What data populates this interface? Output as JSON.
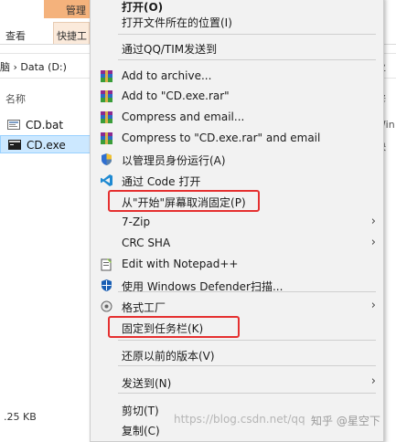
{
  "explorer": {
    "ribbon_tab_manage": "管理",
    "ribbon_tab_view": "查看",
    "ribbon_tab_shortcut": "快捷工",
    "address_path": "脑 › Data (D:)",
    "right_fragment_1": "业",
    "right_fragment_2": "修",
    "right_fragment_3": "Win",
    "right_fragment_4": "快",
    "column_name": "名称",
    "files": [
      {
        "name": "CD.bat",
        "selected": false
      },
      {
        "name": "CD.exe",
        "selected": true
      }
    ],
    "status_size": ".25 KB"
  },
  "context_menu": {
    "items": [
      {
        "label": "打开(O)",
        "icon": "none"
      },
      {
        "label": "打开文件所在的位置(I)",
        "icon": "none"
      },
      {
        "label": "通过QQ/TIM发送到",
        "icon": "none"
      },
      {
        "label": "Add to archive...",
        "icon": "winrar-icon"
      },
      {
        "label": "Add to \"CD.exe.rar\"",
        "icon": "winrar-icon"
      },
      {
        "label": "Compress and email...",
        "icon": "winrar-icon"
      },
      {
        "label": "Compress to \"CD.exe.rar\" and email",
        "icon": "winrar-icon"
      },
      {
        "label": "以管理员身份运行(A)",
        "icon": "uac-shield-icon"
      },
      {
        "label": "通过 Code 打开",
        "icon": "vscode-icon"
      },
      {
        "label": "从\"开始\"屏幕取消固定(P)",
        "icon": "none"
      },
      {
        "label": "7-Zip",
        "icon": "none",
        "submenu": true
      },
      {
        "label": "CRC SHA",
        "icon": "none",
        "submenu": true
      },
      {
        "label": "Edit with Notepad++",
        "icon": "notepad-plus-plus-icon"
      },
      {
        "label": "使用 Windows Defender扫描...",
        "icon": "windows-defender-icon"
      },
      {
        "label": "格式工厂",
        "icon": "format-factory-icon",
        "submenu": true
      },
      {
        "label": "固定到任务栏(K)",
        "icon": "none"
      },
      {
        "label": "还原以前的版本(V)",
        "icon": "none"
      },
      {
        "label": "发送到(N)",
        "icon": "none",
        "submenu": true
      },
      {
        "label": "剪切(T)",
        "icon": "none"
      },
      {
        "label": "复制(C)",
        "icon": "none"
      }
    ],
    "submenu_arrow_glyph": "›"
  },
  "watermark": {
    "url": "https://blog.csdn.net/qq",
    "author": "知乎 @星空下"
  },
  "colors": {
    "highlight": "#e53030",
    "menu_bg": "#f2f2f2",
    "selection": "#cce8ff"
  }
}
